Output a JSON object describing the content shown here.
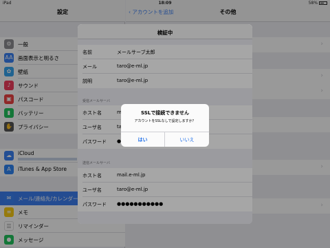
{
  "status_bar": {
    "carrier": "iPad",
    "wifi": "wifi-icon",
    "time": "18:09",
    "battery": "58%"
  },
  "left": {
    "title": "設定",
    "items": [
      {
        "label": "一般",
        "icon": "gear-icon",
        "color": "#8e8e93"
      },
      {
        "label": "画面表示と明るさ",
        "icon": "text-size-icon",
        "color": "#3b82f6"
      },
      {
        "label": "壁紙",
        "icon": "flower-icon",
        "color": "#36a6f0"
      },
      {
        "label": "サウンド",
        "icon": "speaker-icon",
        "color": "#f43f5e"
      },
      {
        "label": "パスコード",
        "icon": "lock-icon",
        "color": "#ef4444"
      },
      {
        "label": "バッテリー",
        "icon": "battery-icon",
        "color": "#22c55e"
      },
      {
        "label": "プライバシー",
        "icon": "hand-icon",
        "color": "#555555"
      },
      {
        "label": "iCloud",
        "icon": "cloud-icon",
        "color": "#3b82f6"
      },
      {
        "label": "iTunes & App Store",
        "icon": "app-store-icon",
        "color": "#2f86f6"
      },
      {
        "label": "メール/連絡先/カレンダー",
        "icon": "mail-icon",
        "color": "#3b82f6"
      },
      {
        "label": "メモ",
        "icon": "notes-icon",
        "color": "#facc15"
      },
      {
        "label": "リマインダー",
        "icon": "list-icon",
        "color": "#ffffff"
      },
      {
        "label": "メッセージ",
        "icon": "message-icon",
        "color": "#22c55e"
      }
    ]
  },
  "right": {
    "back_label": "アカウントを追加",
    "title": "その他"
  },
  "sheet": {
    "title": "検証中",
    "account": [
      {
        "key": "名前",
        "value": "メールサーブ太郎"
      },
      {
        "key": "メール",
        "value": "taro@e-ml.jp"
      },
      {
        "key": "説明",
        "value": "taro@e-ml.jp"
      }
    ],
    "incoming_header": "受信メールサーバ",
    "incoming": [
      {
        "key": "ホスト名",
        "value": "ma"
      },
      {
        "key": "ユーザ名",
        "value": "ta"
      },
      {
        "key": "パスワード",
        "value": "●●"
      }
    ],
    "outgoing_header": "送信メールサーバ",
    "outgoing": [
      {
        "key": "ホスト名",
        "value": "mail.e-ml.jp"
      },
      {
        "key": "ユーザ名",
        "value": "taro@e-ml.jp"
      },
      {
        "key": "パスワード",
        "value": "●●●●●●●●●●●"
      }
    ]
  },
  "alert": {
    "title": "SSLで接続できません",
    "message": "アカウントをSSLなしで設定しますか？",
    "yes_label": "はい",
    "no_label": "いいえ"
  }
}
